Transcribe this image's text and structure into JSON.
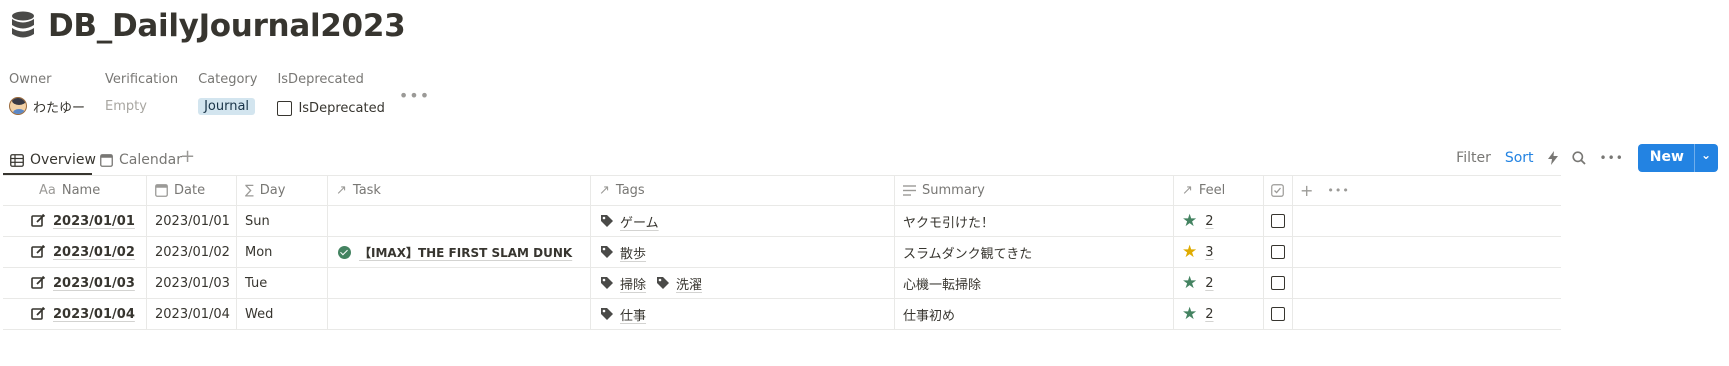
{
  "title": "DB_DailyJournal2023",
  "properties": {
    "owner": {
      "label": "Owner",
      "value": "わたゆー"
    },
    "verification": {
      "label": "Verification",
      "value": "Empty"
    },
    "category": {
      "label": "Category",
      "value": "Journal"
    },
    "is_deprecated": {
      "label": "IsDeprecated",
      "value": "IsDeprecated"
    },
    "more": "•••"
  },
  "views": {
    "tabs": [
      {
        "label": "Overview",
        "active": true
      },
      {
        "label": "Calendar",
        "active": false
      }
    ],
    "add": "+"
  },
  "toolbar": {
    "filter": "Filter",
    "sort": "Sort",
    "more": "•••",
    "new_label": "New",
    "new_caret": "⌄"
  },
  "columns": {
    "name": "Name",
    "name_prefix": "Aa",
    "date": "Date",
    "day": "Day",
    "task": "Task",
    "tags": "Tags",
    "summary": "Summary",
    "feel": "Feel",
    "add": "+",
    "more": "•••"
  },
  "rows": [
    {
      "name": "2023/01/01",
      "date": "2023/01/01",
      "day": "Sun",
      "task": "",
      "tags": [
        "ゲーム"
      ],
      "summary": "ヤクモ引けた！",
      "feel": "2",
      "checked": false
    },
    {
      "name": "2023/01/02",
      "date": "2023/01/02",
      "day": "Mon",
      "task": "【IMAX】THE FIRST SLAM DUNK",
      "tags": [
        "散歩"
      ],
      "summary": "スラムダンク観てきた",
      "feel": "3",
      "checked": false
    },
    {
      "name": "2023/01/03",
      "date": "2023/01/03",
      "day": "Tue",
      "task": "",
      "tags": [
        "掃除",
        "洗濯"
      ],
      "summary": "心機一転掃除",
      "feel": "2",
      "checked": false
    },
    {
      "name": "2023/01/04",
      "date": "2023/01/04",
      "day": "Wed",
      "task": "",
      "tags": [
        "仕事"
      ],
      "summary": "仕事初め",
      "feel": "2",
      "checked": false
    }
  ],
  "colors": {
    "accent": "#2383e2",
    "star_green": "#448361",
    "star_gold": "#dfab01",
    "category_bg": "#d3e5ef"
  },
  "icons": [
    "database-icon",
    "table-icon",
    "calendar-icon",
    "bolt-icon",
    "search-icon",
    "page-edit-icon",
    "tag-icon",
    "star-icon",
    "check-circle-icon",
    "checkbox-icon"
  ]
}
